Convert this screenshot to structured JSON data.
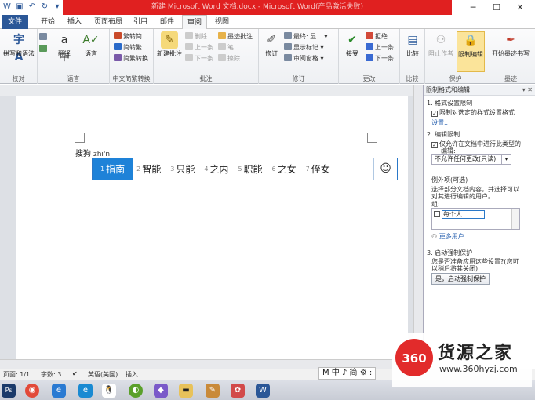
{
  "window": {
    "title": "新建 Microsoft Word 文档.docx - Microsoft Word(产品激活失败)",
    "controls": [
      "─",
      "☐",
      "✕"
    ]
  },
  "tabs": [
    "文件",
    "开始",
    "插入",
    "页面布局",
    "引用",
    "邮件",
    "审阅",
    "视图"
  ],
  "ribbon": {
    "proofing": {
      "big": "拼写和语法",
      "label": "校对"
    },
    "language": {
      "translate": "翻译",
      "language": "语言",
      "label": "语言"
    },
    "chinese": {
      "items": [
        "繁转简",
        "简转繁",
        "简繁转换"
      ],
      "label": "中文简繁转换"
    },
    "comments": {
      "new": "新建批注",
      "items": [
        "删除",
        "上一条",
        "下一条"
      ],
      "label": "批注",
      "ink": [
        "墨迹批注",
        "笔",
        "擦除"
      ]
    },
    "tracking": {
      "big": "修订",
      "items": [
        "最终: 显...",
        "显示标记",
        "审阅窗格"
      ],
      "label": "修订"
    },
    "changes": {
      "accept": "接受",
      "items": [
        "拒绝",
        "上一条",
        "下一条"
      ],
      "label": "更改"
    },
    "compare": {
      "big": "比较",
      "label": "比较"
    },
    "protect": {
      "block": "阻止作者",
      "restrict": "限制编辑",
      "label": "保护"
    },
    "ink": {
      "big": "开始墨迹书写",
      "label": "墨迹"
    }
  },
  "document": {
    "typed_prefix": "搜狗",
    "pinyin": "zhi'n",
    "candidates": [
      {
        "num": "1",
        "text": "指南"
      },
      {
        "num": "2",
        "text": "智能"
      },
      {
        "num": "3",
        "text": "只能"
      },
      {
        "num": "4",
        "text": "之内"
      },
      {
        "num": "5",
        "text": "职能"
      },
      {
        "num": "6",
        "text": "之女"
      },
      {
        "num": "7",
        "text": "侄女"
      }
    ],
    "emoji_button": "☺"
  },
  "pane": {
    "title": "限制格式和编辑",
    "s1_title": "1. 格式设置限制",
    "s1_check": "限制对选定的样式设置格式",
    "s1_link": "设置...",
    "s2_title": "2. 编辑限制",
    "s2_check_line1": "仅允许在文档中进行此类型的",
    "s2_check_line2": "编辑:",
    "s2_select": "不允许任何更改(只读)",
    "exceptions_title": "例外项(可选)",
    "exceptions_desc1": "选择部分文档内容，并选择可以",
    "exceptions_desc2": "对其进行编辑的用户。",
    "group_label": "组:",
    "group_everyone": "每个人",
    "more_users": "更多用户...",
    "s3_title": "3. 启动强制保护",
    "s3_desc1": "您是否准备应用这些设置?(您可",
    "s3_desc2": "以稍后将其关闭)",
    "s3_button": "是，启动强制保护"
  },
  "status": {
    "page": "页面: 1/1",
    "words": "字数: 3",
    "lang": "英语(美国)",
    "mode": "插入"
  },
  "ime": {
    "text": "M 中 ♪ 简 ⚙ :"
  },
  "watermark": {
    "brand": "货源之家",
    "url": "www.360hyzj.com",
    "logo": "360"
  },
  "colors": {
    "file_tab": "#2b5797",
    "title_red": "#e02020",
    "ime_sel": "#1e82d8"
  }
}
